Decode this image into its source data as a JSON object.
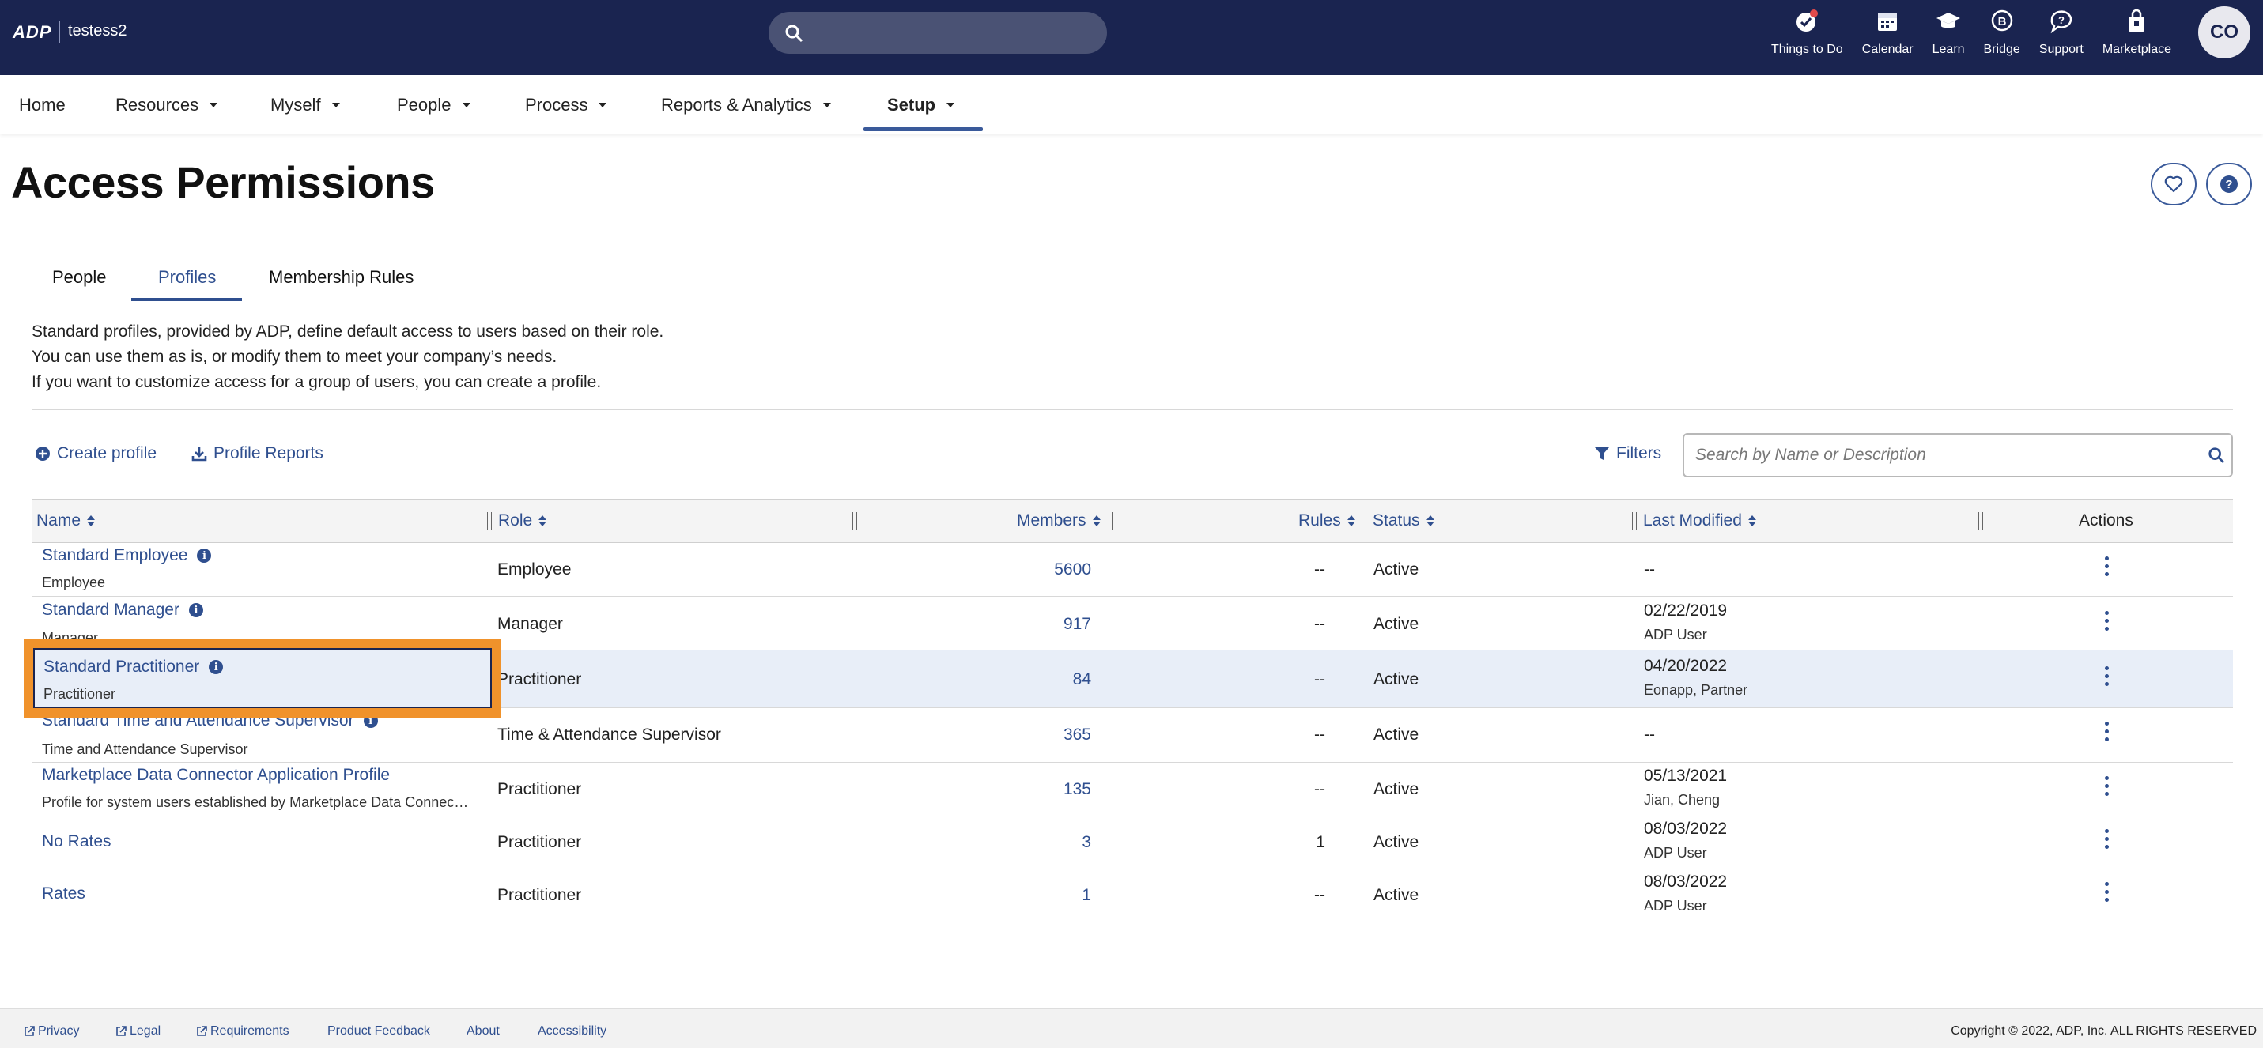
{
  "topbar": {
    "logo": "ADP",
    "company": "testess2",
    "icons": [
      {
        "label": "Things to Do",
        "icon": "checklist-badge-icon"
      },
      {
        "label": "Calendar",
        "icon": "calendar-icon"
      },
      {
        "label": "Learn",
        "icon": "graduation-cap-icon"
      },
      {
        "label": "Bridge",
        "icon": "bridge-icon"
      },
      {
        "label": "Support",
        "icon": "chat-question-icon"
      },
      {
        "label": "Marketplace",
        "icon": "marketplace-bag-icon"
      }
    ],
    "avatar_initials": "CO"
  },
  "nav": {
    "items": [
      {
        "label": "Home"
      },
      {
        "label": "Resources"
      },
      {
        "label": "Myself"
      },
      {
        "label": "People"
      },
      {
        "label": "Process"
      },
      {
        "label": "Reports & Analytics"
      },
      {
        "label": "Setup"
      }
    ],
    "active": "Setup"
  },
  "page": {
    "title": "Access Permissions",
    "tabs": [
      "People",
      "Profiles",
      "Membership Rules"
    ],
    "active_tab": "Profiles",
    "description": [
      "Standard profiles, provided by ADP, define default access to users based on their role.",
      "You can use them as is, or modify them to meet your company’s needs.",
      "If you want to customize access for a group of users, you can create a profile."
    ]
  },
  "toolbar": {
    "create_label": "Create profile",
    "reports_label": "Profile Reports",
    "filters_label": "Filters",
    "search_placeholder": "Search by Name or Description"
  },
  "table": {
    "headers": {
      "name": "Name",
      "role": "Role",
      "members": "Members",
      "rules": "Rules",
      "status": "Status",
      "last_modified": "Last Modified",
      "actions": "Actions"
    },
    "rows": [
      {
        "name": "Standard Employee",
        "sub": "Employee",
        "info": true,
        "role": "Employee",
        "members": "5600",
        "rules": "--",
        "status": "Active",
        "modified": "--",
        "modified_by": ""
      },
      {
        "name": "Standard Manager",
        "sub": "Manager",
        "info": true,
        "role": "Manager",
        "members": "917",
        "rules": "--",
        "status": "Active",
        "modified": "02/22/2019",
        "modified_by": "ADP User"
      },
      {
        "name": "Standard Practitioner",
        "sub": "Practitioner",
        "info": true,
        "role": "Practitioner",
        "members": "84",
        "rules": "--",
        "status": "Active",
        "modified": "04/20/2022",
        "modified_by": "Eonapp, Partner"
      },
      {
        "name": "Standard Time and Attendance Supervisor",
        "sub": "Time and Attendance Supervisor",
        "info": true,
        "role": "Time & Attendance Supervisor",
        "members": "365",
        "rules": "--",
        "status": "Active",
        "modified": "--",
        "modified_by": ""
      },
      {
        "name": "Marketplace Data Connector Application Profile",
        "sub": "Profile for system users established by Marketplace Data Connec…",
        "info": false,
        "role": "Practitioner",
        "members": "135",
        "rules": "--",
        "status": "Active",
        "modified": "05/13/2021",
        "modified_by": "Jian, Cheng"
      },
      {
        "name": "No Rates",
        "sub": "",
        "info": false,
        "role": "Practitioner",
        "members": "3",
        "rules": "1",
        "status": "Active",
        "modified": "08/03/2022",
        "modified_by": "ADP User"
      },
      {
        "name": "Rates",
        "sub": "",
        "info": false,
        "role": "Practitioner",
        "members": "1",
        "rules": "--",
        "status": "Active",
        "modified": "08/03/2022",
        "modified_by": "ADP User"
      }
    ]
  },
  "footer": {
    "links": [
      "Privacy",
      "Legal",
      "Requirements",
      "Product Feedback",
      "About",
      "Accessibility"
    ],
    "copyright": "Copyright © 2022, ADP, Inc. ALL RIGHTS RESERVED"
  },
  "colors": {
    "topbar": "#1a2450",
    "link": "#2f4f8f",
    "highlight": "#f0922b",
    "selected_row": "#e8eef8"
  }
}
